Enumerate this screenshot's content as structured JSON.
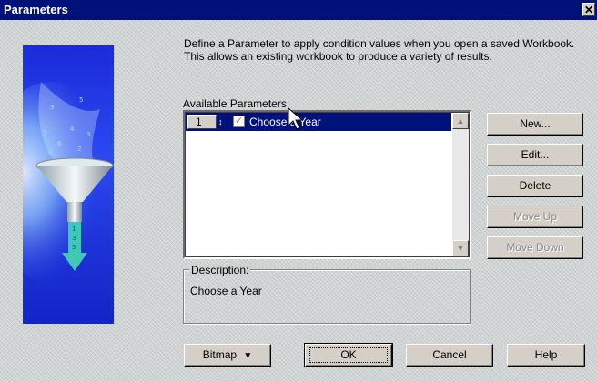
{
  "window": {
    "title": "Parameters",
    "close_glyph": "✕"
  },
  "description_text": "Define a Parameter to apply condition values when you open a saved Workbook. This allows an existing workbook to produce a variety of results.",
  "available_parameters": {
    "label": "Available Parameters:",
    "items": [
      {
        "number": "1",
        "checked": true,
        "label": "Choose a Year",
        "selected": true
      }
    ]
  },
  "description_group": {
    "legend": "Description:",
    "value": "Choose a Year"
  },
  "side_buttons": {
    "new": "New...",
    "edit": "Edit...",
    "delete": "Delete",
    "move_up": "Move Up",
    "move_down": "Move Down"
  },
  "bottom_buttons": {
    "bitmap": "Bitmap",
    "ok": "OK",
    "cancel": "Cancel",
    "help": "Help"
  },
  "icons": {
    "close": "close-icon",
    "funnel": "funnel-illustration",
    "checkbox": "checkbox-icon",
    "scroll_up": "scroll-up-icon",
    "scroll_down": "scroll-down-icon",
    "dropdown": "dropdown-arrow-icon",
    "cursor": "mouse-pointer-icon"
  },
  "colors": {
    "titlebar": "#00127a",
    "selection": "#00127a",
    "dialog_bg": "#cfd2d3",
    "illustration_blue": "#1b2bd9"
  }
}
